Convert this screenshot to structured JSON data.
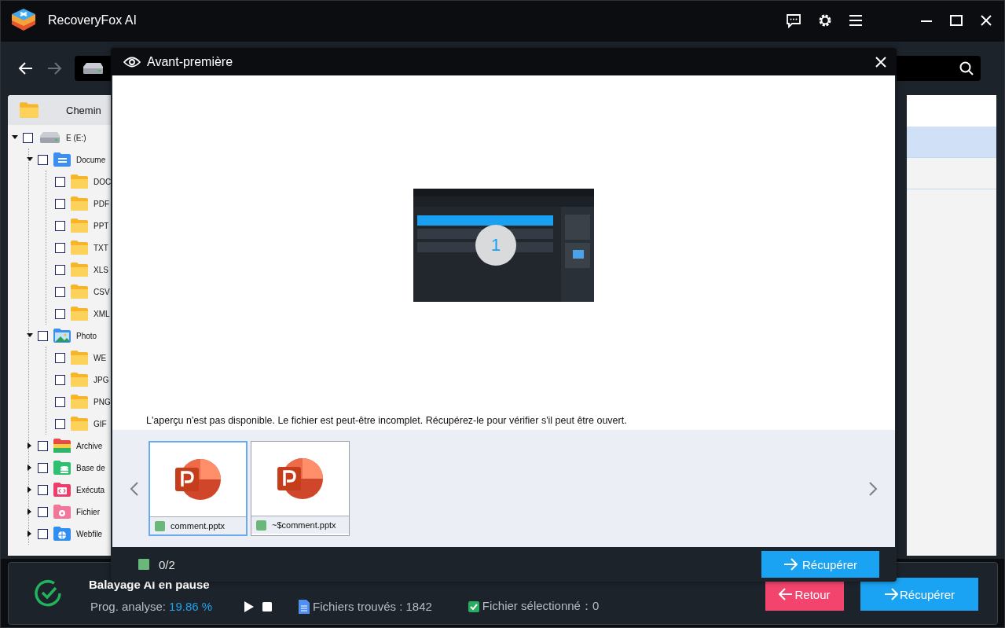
{
  "app": {
    "title": "RecoveryFox AI"
  },
  "tree": {
    "header": "Chemin",
    "items": [
      {
        "label": "E (E:)",
        "kind": "drive",
        "checked": false,
        "expanded": true,
        "children": [
          {
            "label": "Docume",
            "kind": "documents",
            "checked": false,
            "expanded": true,
            "children": [
              {
                "label": "DOC",
                "kind": "folder",
                "checked": false
              },
              {
                "label": "PDF",
                "kind": "folder",
                "checked": false
              },
              {
                "label": "PPT",
                "kind": "folder",
                "checked": false
              },
              {
                "label": "TXT",
                "kind": "folder",
                "checked": false
              },
              {
                "label": "XLS",
                "kind": "folder",
                "checked": false
              },
              {
                "label": "CSV",
                "kind": "folder",
                "checked": false
              },
              {
                "label": "XML",
                "kind": "folder",
                "checked": false
              }
            ]
          },
          {
            "label": "Photo",
            "checked": false,
            "expanded": true,
            "children": [
              {
                "label": "WE",
                "kind": "folder",
                "checked": false
              },
              {
                "label": "JPG",
                "kind": "folder",
                "checked": false
              },
              {
                "label": "PNG",
                "kind": "folder",
                "checked": false
              },
              {
                "label": "GIF",
                "kind": "folder",
                "checked": false
              }
            ]
          },
          {
            "label": "Archive",
            "kind": "archive",
            "checked": false,
            "expanded": false
          },
          {
            "label": "Base de",
            "kind": "database",
            "checked": false,
            "expanded": false
          },
          {
            "label": "Exécuta",
            "kind": "executable",
            "checked": false,
            "expanded": false
          },
          {
            "label": "Fichier",
            "kind": "settings",
            "checked": false,
            "expanded": false
          },
          {
            "label": "Webfile",
            "kind": "web",
            "checked": false,
            "expanded": false
          }
        ]
      }
    ]
  },
  "list_rows": [
    {
      "selected": true
    },
    {
      "selected": false
    }
  ],
  "status": {
    "title": "Balayage AI en pause",
    "progress_label": "Prog. analyse:",
    "progress_value": "19.86 %",
    "found": "Fichiers trouvés : 1842",
    "selected_label": "Fichier sélectionné：0",
    "selected_checked": true
  },
  "buttons": [
    {
      "label": "Retour",
      "kind": "back"
    },
    {
      "label": "Récupérer",
      "kind": "recover"
    }
  ],
  "preview": {
    "title": "Avant-première",
    "page_number": "1",
    "message": "L'aperçu n'est pas disponible. Le fichier est peut-être incomplet. Récupérez-le pour vérifier s'il peut être ouvert.",
    "thumbnails": [
      {
        "name": "comment.pptx",
        "selected": true
      },
      {
        "name": "~$comment.pptx",
        "selected": false
      }
    ],
    "count": "0/2",
    "recover": "Récupérer"
  }
}
